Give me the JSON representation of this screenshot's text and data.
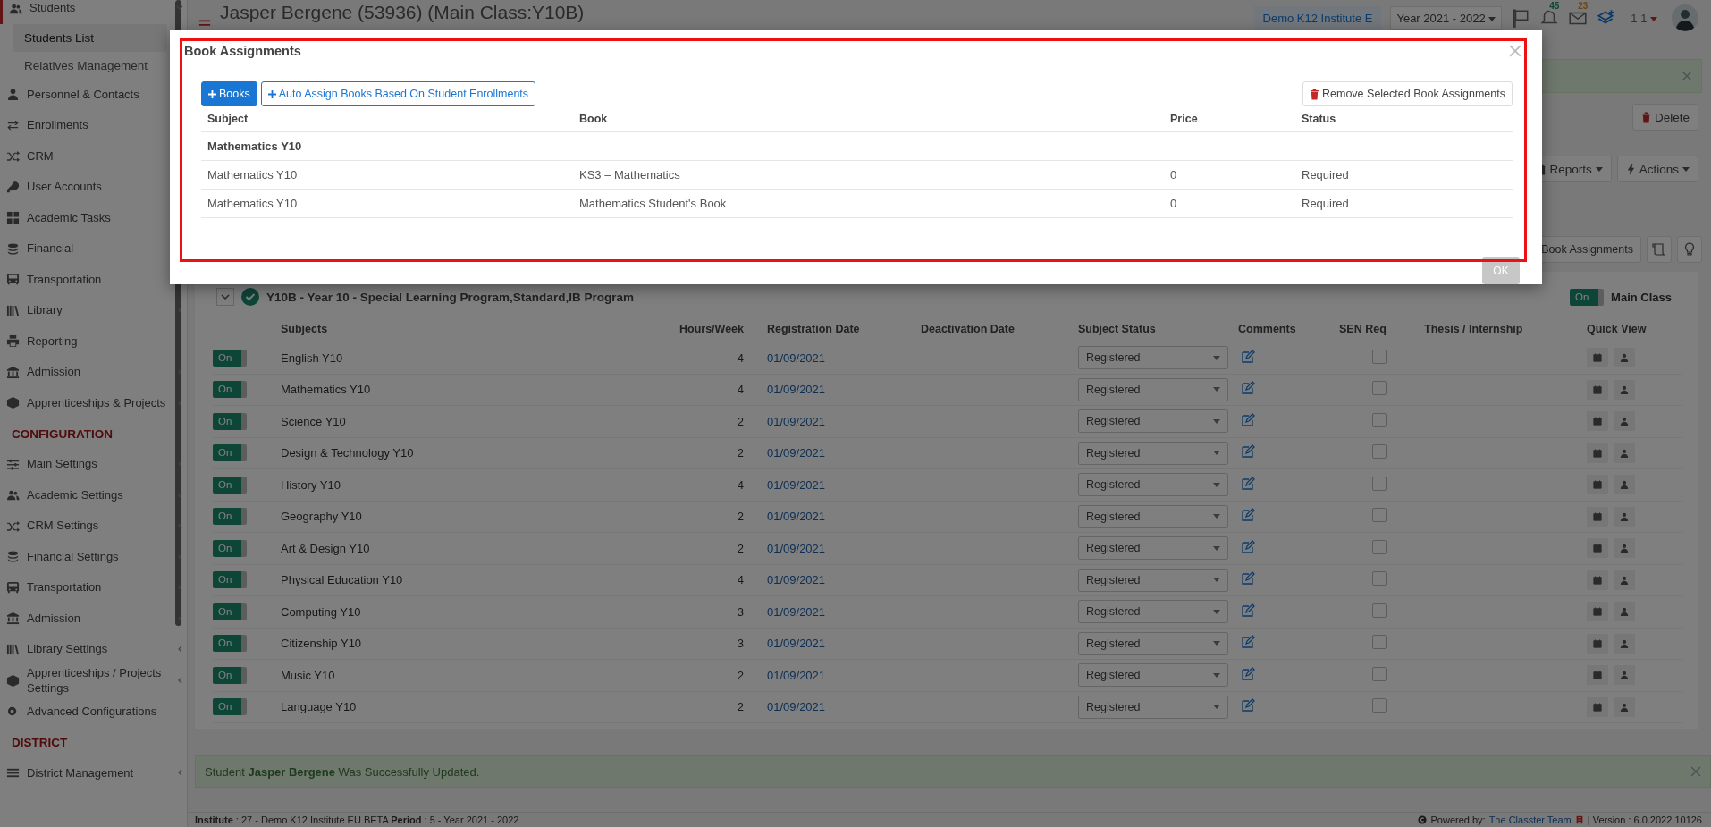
{
  "sidebar": {
    "items": [
      {
        "kind": "item",
        "label": "Students",
        "has_submenu": true,
        "expanded": true,
        "children": [
          {
            "label": "Students List",
            "selected": true
          },
          {
            "label": "Relatives Management",
            "selected": false
          }
        ]
      },
      {
        "kind": "item",
        "label": "Personnel & Contacts"
      },
      {
        "kind": "item",
        "label": "Enrollments"
      },
      {
        "kind": "item",
        "label": "CRM"
      },
      {
        "kind": "item",
        "label": "User Accounts"
      },
      {
        "kind": "item",
        "label": "Academic Tasks"
      },
      {
        "kind": "item",
        "label": "Financial"
      },
      {
        "kind": "item",
        "label": "Transportation"
      },
      {
        "kind": "item",
        "label": "Library",
        "has_submenu": true,
        "expanded": false
      },
      {
        "kind": "item",
        "label": "Reporting"
      },
      {
        "kind": "item",
        "label": "Admission",
        "has_submenu": true,
        "expanded": false
      },
      {
        "kind": "item",
        "label": "Apprenticeships & Projects",
        "has_submenu": true,
        "expanded": false
      },
      {
        "kind": "heading",
        "label": "CONFIGURATION"
      },
      {
        "kind": "item",
        "label": "Main Settings",
        "has_submenu": true,
        "expanded": false
      },
      {
        "kind": "item",
        "label": "Academic Settings",
        "has_submenu": true,
        "expanded": false
      },
      {
        "kind": "item",
        "label": "CRM Settings",
        "has_submenu": true,
        "expanded": false
      },
      {
        "kind": "item",
        "label": "Financial Settings",
        "has_submenu": true,
        "expanded": false
      },
      {
        "kind": "item",
        "label": "Transportation",
        "has_submenu": true,
        "expanded": false
      },
      {
        "kind": "item",
        "label": "Admission",
        "has_submenu": true,
        "expanded": false
      },
      {
        "kind": "item",
        "label": "Library Settings",
        "has_submenu": true,
        "expanded": false
      },
      {
        "kind": "item",
        "label": "Apprenticeships / Projects Settings",
        "has_submenu": true,
        "expanded": false
      },
      {
        "kind": "item",
        "label": "Advanced Configurations"
      },
      {
        "kind": "heading",
        "label": "DISTRICT"
      },
      {
        "kind": "item",
        "label": "District Management",
        "has_submenu": true,
        "expanded": false
      }
    ]
  },
  "header": {
    "title": "Jasper Bergene (53936) (Main Class:Y10B)",
    "institute": "Demo K12 Institute E",
    "year": "Year 2021 - 2022",
    "notifications_count": "45",
    "messages_count": "23",
    "user": "1 1"
  },
  "toolbar": {
    "delete_button": "Delete",
    "reports_button": "Reports",
    "actions_button": "Actions",
    "book_assignments_button": "Book Assignments"
  },
  "class_section": {
    "title": "Y10B - Year 10 - Special Learning Program,Standard,IB Program",
    "main_class_toggle": {
      "label": "On",
      "on": true
    },
    "main_class_label": "Main Class"
  },
  "table": {
    "columns": [
      "Subjects",
      "Hours/Week",
      "Registration Date",
      "Deactivation Date",
      "Subject Status",
      "Comments",
      "SEN Req",
      "Thesis / Internship",
      "Quick View"
    ],
    "rows": [
      {
        "toggle": "On",
        "on": true,
        "subject": "English Y10",
        "hours": "4",
        "registration_date": "01/09/2021",
        "status": "Registered",
        "sen_req": false
      },
      {
        "toggle": "On",
        "on": true,
        "subject": "Mathematics Y10",
        "hours": "4",
        "registration_date": "01/09/2021",
        "status": "Registered",
        "sen_req": false
      },
      {
        "toggle": "On",
        "on": true,
        "subject": "Science Y10",
        "hours": "2",
        "registration_date": "01/09/2021",
        "status": "Registered",
        "sen_req": false
      },
      {
        "toggle": "On",
        "on": true,
        "subject": "Design & Technology Y10",
        "hours": "2",
        "registration_date": "01/09/2021",
        "status": "Registered",
        "sen_req": false
      },
      {
        "toggle": "On",
        "on": true,
        "subject": "History Y10",
        "hours": "4",
        "registration_date": "01/09/2021",
        "status": "Registered",
        "sen_req": false
      },
      {
        "toggle": "On",
        "on": true,
        "subject": "Geography Y10",
        "hours": "2",
        "registration_date": "01/09/2021",
        "status": "Registered",
        "sen_req": false
      },
      {
        "toggle": "On",
        "on": true,
        "subject": "Art & Design Y10",
        "hours": "2",
        "registration_date": "01/09/2021",
        "status": "Registered",
        "sen_req": false
      },
      {
        "toggle": "On",
        "on": true,
        "subject": "Physical Education Y10",
        "hours": "4",
        "registration_date": "01/09/2021",
        "status": "Registered",
        "sen_req": false
      },
      {
        "toggle": "On",
        "on": true,
        "subject": "Computing Y10",
        "hours": "3",
        "registration_date": "01/09/2021",
        "status": "Registered",
        "sen_req": false
      },
      {
        "toggle": "On",
        "on": true,
        "subject": "Citizenship Y10",
        "hours": "3",
        "registration_date": "01/09/2021",
        "status": "Registered",
        "sen_req": false
      },
      {
        "toggle": "On",
        "on": true,
        "subject": "Music Y10",
        "hours": "2",
        "registration_date": "01/09/2021",
        "status": "Registered",
        "sen_req": false
      },
      {
        "toggle": "On",
        "on": true,
        "subject": "Language Y10",
        "hours": "2",
        "registration_date": "01/09/2021",
        "status": "Registered",
        "sen_req": false
      }
    ]
  },
  "success_alert": "Student **Jasper Bergene** Was Successfully Updated.",
  "footer": {
    "info": "**Institute** : 27 - Demo K12 Institute EU BETA **Period** : 5 - Year 2021 - 2022",
    "powered_by": "Powered by:",
    "link": "The Classter Team",
    "version": "| Version : 6.0.2022.10126"
  },
  "modal": {
    "title": "Book Assignments",
    "add_button": "Books",
    "auto_assign_button": "Auto Assign Books Based On Student Enrollments",
    "remove_button": "Remove Selected Book Assignments",
    "columns": [
      "Subject",
      "Book",
      "Price",
      "Status"
    ],
    "groups": [
      {
        "name": "Mathematics Y10",
        "rows": [
          {
            "subject": "Mathematics Y10",
            "book": "KS3 – Mathematics",
            "price": "0",
            "status": "Required"
          },
          {
            "subject": "Mathematics Y10",
            "book": "Mathematics Student's Book",
            "price": "0",
            "status": "Required"
          }
        ]
      }
    ],
    "ok_button": "OK"
  }
}
